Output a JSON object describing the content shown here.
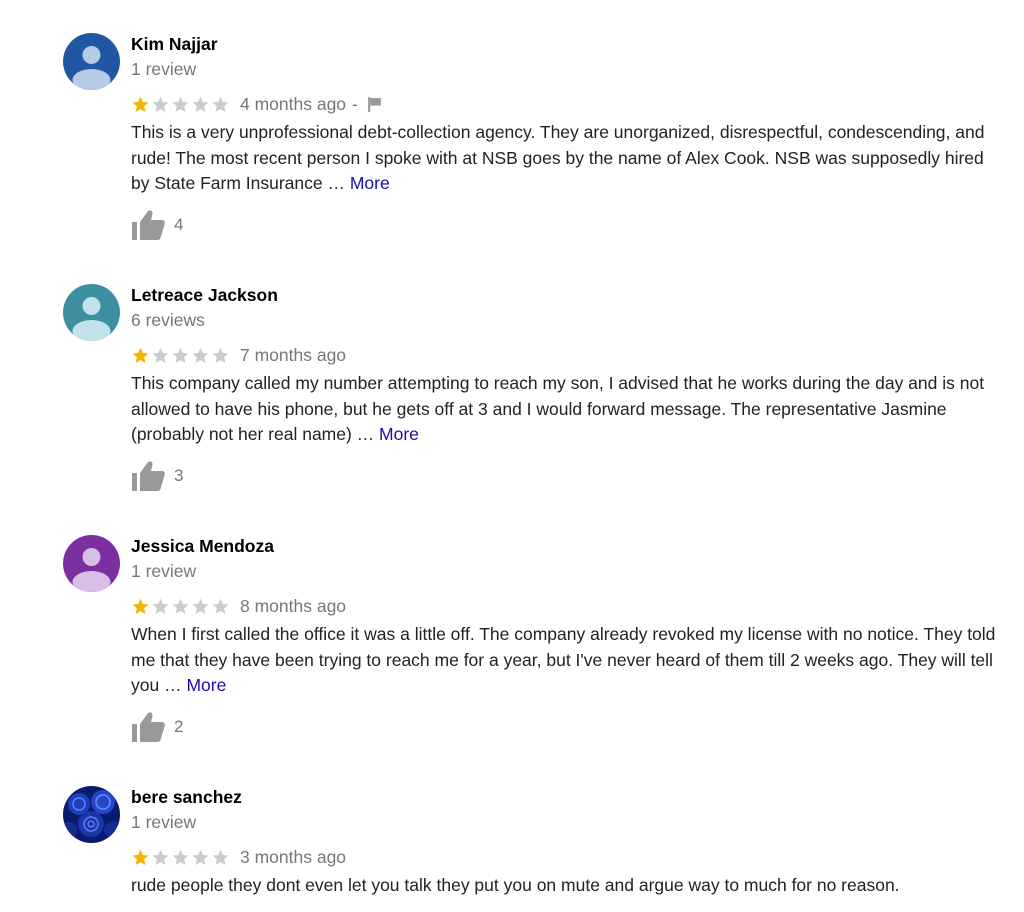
{
  "colors": {
    "star_filled": "#f4b400",
    "star_empty": "#cccccc",
    "link": "#1a0dab",
    "muted": "#777777",
    "icon_gray": "#999999"
  },
  "reviews": [
    {
      "name": "Kim Najjar",
      "review_count": "1 review",
      "rating": 1,
      "date": "4 months ago",
      "separator": "-",
      "has_flag": true,
      "text": "This is a very unprofessional debt-collection agency. They are unorganized, disrespectful, condescending, and rude! The most recent person I spoke with at NSB goes by the name of Alex Cook. NSB was supposedly hired by State Farm Insurance … ",
      "more": "More",
      "likes": "4",
      "avatar": "person-icon-blue"
    },
    {
      "name": "Letreace Jackson",
      "review_count": "6 reviews",
      "rating": 1,
      "date": "7 months ago",
      "text": "This company called my number attempting to reach my son, I advised that he works during the day and is not allowed to have his phone, but he gets off at 3 and I would forward message. The representative Jasmine (probably not her real name) … ",
      "more": "More",
      "likes": "3",
      "avatar": "person-icon-teal"
    },
    {
      "name": "Jessica Mendoza",
      "review_count": "1 review",
      "rating": 1,
      "date": "8 months ago",
      "text": "When I first called the office it was a little off. The company already revoked my license with no notice. They told me that they have been trying to reach me for a year, but I've never heard of them till 2 weeks ago. They will tell you … ",
      "more": "More",
      "likes": "2",
      "avatar": "person-icon-purple"
    },
    {
      "name": "bere sanchez",
      "review_count": "1 review",
      "rating": 1,
      "date": "3 months ago",
      "text": "rude people they dont even let you talk they put you on mute and argue way to much for no reason.",
      "avatar": "blue-roses-photo"
    }
  ]
}
